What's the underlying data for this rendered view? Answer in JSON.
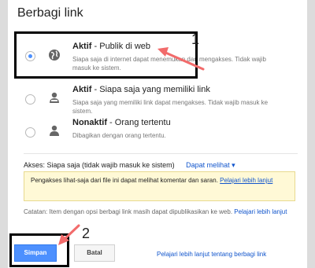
{
  "dialog": {
    "title": "Berbagi link"
  },
  "options": [
    {
      "name_bold": "Aktif",
      "name_rest": " - Publik di web",
      "description": "Siapa saja di internet dapat menemukan dan mengakses. Tidak wajib masuk ke sistem.",
      "icon": "globe-icon",
      "selected": true
    },
    {
      "name_bold": "Aktif",
      "name_rest": " - Siapa saja yang memiliki link",
      "description": "Siapa saja yang memiliki link dapat mengakses. Tidak wajib masuk ke sistem.",
      "icon": "person-link-icon",
      "selected": false
    },
    {
      "name_bold": "Nonaktif",
      "name_rest": " - Orang tertentu",
      "description": "Dibagikan dengan orang tertentu.",
      "icon": "person-icon",
      "selected": false
    }
  ],
  "annotations": {
    "num1": "1",
    "num2": "2"
  },
  "access": {
    "label": "Akses:",
    "value": "Siapa saja (tidak wajib masuk ke sistem)",
    "permission": "Dapat melihat ▾"
  },
  "notice": {
    "text": "Pengakses lihat-saja dari file ini dapat melihat komentar dan saran.",
    "link": "Pelajari lebih lanjut"
  },
  "note": {
    "text": "Catatan: Item dengan opsi berbagi link masih dapat dipublikasikan ke web.",
    "link": "Pelajari lebih lanjut"
  },
  "buttons": {
    "save": "Simpan",
    "cancel": "Batal",
    "learn_more": "Pelajari lebih lanjut tentang berbagi link"
  },
  "colors": {
    "primary": "#4d90fe",
    "link": "#1155cc",
    "notice_bg": "#fff9d6",
    "arrow": "#f26b6b"
  }
}
